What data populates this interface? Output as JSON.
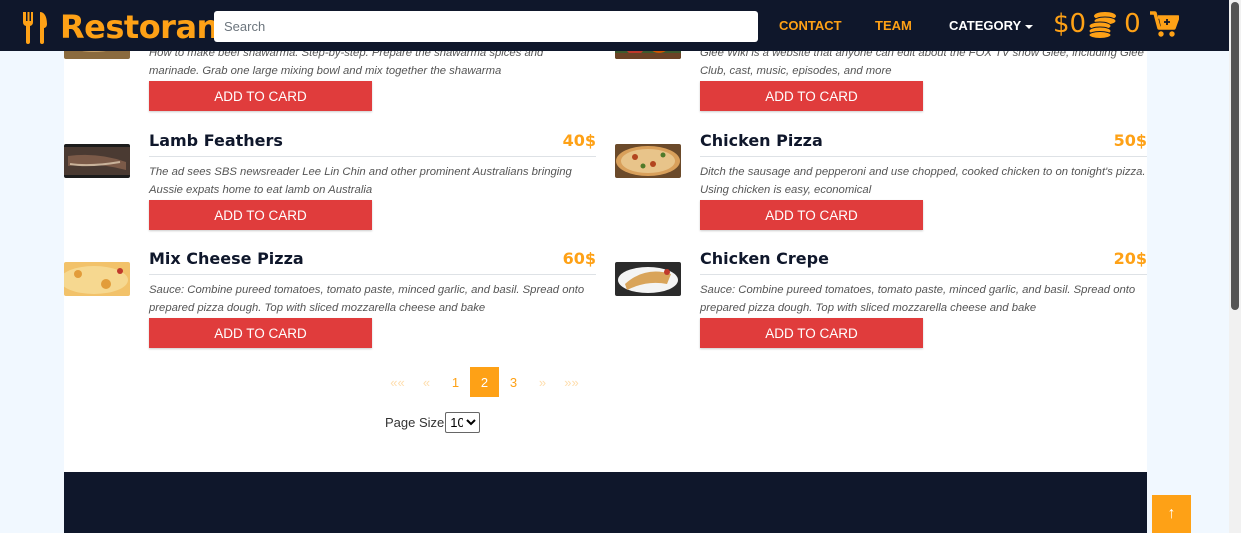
{
  "brand": {
    "name": "Restoran",
    "icon": "utensils-icon"
  },
  "search": {
    "placeholder": "Search"
  },
  "nav": {
    "contact": "CONTACT",
    "team": "TEAM",
    "category": "CATEGORY"
  },
  "cart": {
    "total": "$0",
    "count": "0"
  },
  "items": [
    {
      "name": "",
      "price": "",
      "desc": "How to make beef shawarma. Step-by-step. Prepare the shawarma spices and marinade. Grab one large mixing bowl and mix together the shawarma",
      "button": "ADD TO CARD",
      "image": "shawarma-image"
    },
    {
      "name": "",
      "price": "",
      "desc": "Glee Wiki is a website that anyone can edit about the FOX TV show Glee, including Glee Club, cast, music, episodes, and more",
      "button": "ADD TO CARD",
      "image": "glee-dish-image"
    },
    {
      "name": "Lamb Feathers",
      "price": "40$",
      "desc": "The ad sees SBS newsreader Lee Lin Chin and other prominent Australians bringing Aussie expats home to eat lamb on Australia",
      "button": "ADD TO CARD",
      "image": "lamb-image"
    },
    {
      "name": "Chicken Pizza",
      "price": "50$",
      "desc": "Ditch the sausage and pepperoni and use chopped, cooked chicken to on tonight's pizza. Using chicken is easy, economical",
      "button": "ADD TO CARD",
      "image": "chicken-pizza-image"
    },
    {
      "name": "Mix Cheese Pizza",
      "price": "60$",
      "desc": "Sauce: Combine pureed tomatoes, tomato paste, minced garlic, and basil. Spread onto prepared pizza dough. Top with sliced mozzarella cheese and bake",
      "button": "ADD TO CARD",
      "image": "cheese-pizza-image"
    },
    {
      "name": "Chicken Crepe",
      "price": "20$",
      "desc": "Sauce: Combine pureed tomatoes, tomato paste, minced garlic, and basil. Spread onto prepared pizza dough. Top with sliced mozzarella cheese and bake",
      "button": "ADD TO CARD",
      "image": "crepe-image"
    }
  ],
  "pagination": {
    "first": "««",
    "prev": "«",
    "pages": [
      "1",
      "2",
      "3"
    ],
    "current": "2",
    "next": "»",
    "last": "»»"
  },
  "page_size": {
    "label": "Page Size",
    "value": "10"
  },
  "back_to_top": "↑",
  "colors": {
    "primary": "#fea116",
    "dark": "#0f172b",
    "button": "#e03c3c"
  }
}
